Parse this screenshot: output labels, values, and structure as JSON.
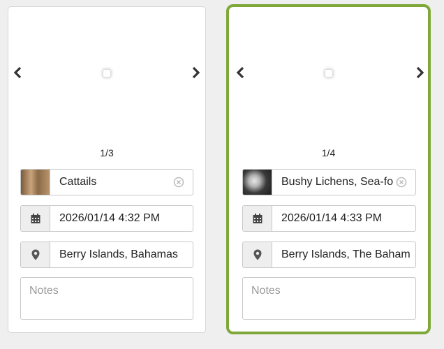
{
  "cards": [
    {
      "counter": "1/3",
      "species": "Cattails",
      "datetime": "2026/01/14 4:32 PM",
      "location": "Berry Islands, Bahamas",
      "notes_placeholder": "Notes",
      "thumb_colors": [
        "#8a6a48",
        "#c9a47c"
      ]
    },
    {
      "counter": "1/4",
      "species": "Bushy Lichens, Sea-fo",
      "datetime": "2026/01/14 4:33 PM",
      "location": "Berry Islands, The Baham",
      "notes_placeholder": "Notes",
      "thumb_colors": [
        "#2e2e2e",
        "#d8d8d8"
      ],
      "selected": true
    }
  ],
  "colors": {
    "selected_border": "#7fa83a",
    "addon_bg": "#eeeeee"
  },
  "icons": [
    "chevron-left-icon",
    "chevron-right-icon",
    "calendar-icon",
    "map-pin-icon",
    "clear-icon"
  ]
}
